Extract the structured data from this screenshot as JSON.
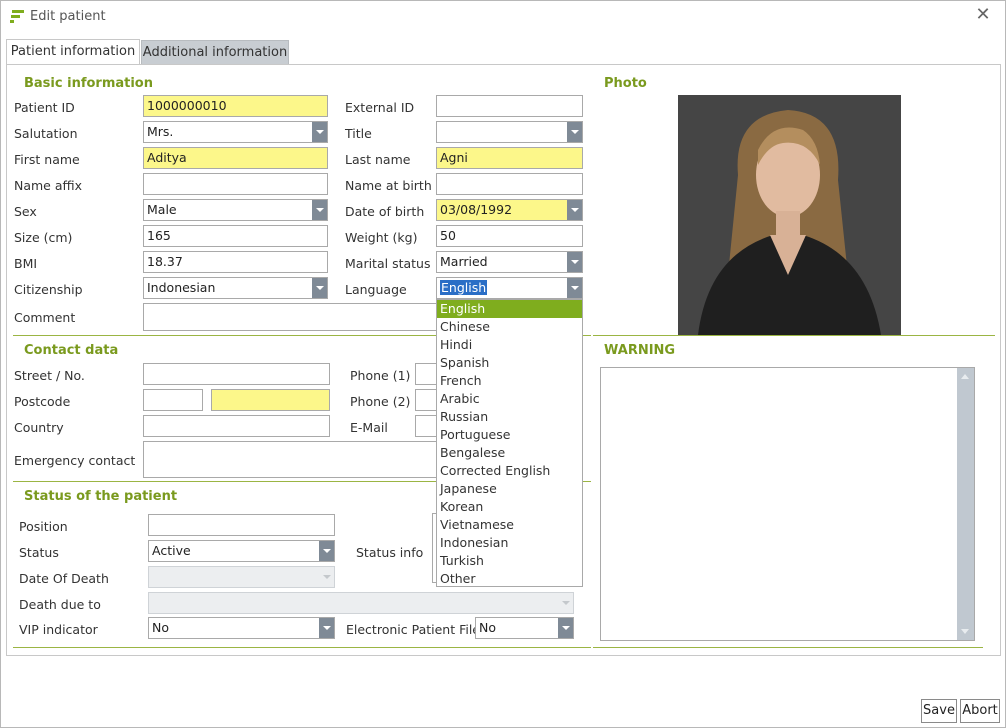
{
  "window": {
    "title": "Edit patient"
  },
  "tabs": [
    {
      "label": "Patient information"
    },
    {
      "label": "Additional information"
    }
  ],
  "basic": {
    "title": "Basic information",
    "patient_id_label": "Patient ID",
    "patient_id": "1000000010",
    "external_id_label": "External ID",
    "external_id": "",
    "salutation_label": "Salutation",
    "salutation": "Mrs.",
    "title_label": "Title",
    "title_value": "",
    "first_name_label": "First name",
    "first_name": "Aditya",
    "last_name_label": "Last name",
    "last_name": "Agni",
    "name_affix_label": "Name affix",
    "name_affix": "",
    "name_at_birth_label": "Name at birth",
    "name_at_birth": "",
    "sex_label": "Sex",
    "sex": "Male",
    "dob_label": "Date of birth",
    "dob": "03/08/1992",
    "size_label": "Size (cm)",
    "size": "165",
    "weight_label": "Weight (kg)",
    "weight": "50",
    "bmi_label": "BMI",
    "bmi": "18.37",
    "marital_label": "Marital status",
    "marital": "Married",
    "citizenship_label": "Citizenship",
    "citizenship": "Indonesian",
    "language_label": "Language",
    "language": "English",
    "comment_label": "Comment",
    "comment": ""
  },
  "photo": {
    "title": "Photo"
  },
  "contact": {
    "title": "Contact data",
    "street_label": "Street / No.",
    "street": "",
    "postcode_label": "Postcode",
    "postcode": "",
    "city": "",
    "country_label": "Country",
    "country": "",
    "emergency_label": "Emergency contact",
    "emergency": "",
    "phone1_label": "Phone (1)",
    "phone2_label": "Phone (2)",
    "email_label": "E-Mail"
  },
  "warning": {
    "title": "WARNING"
  },
  "status": {
    "title": "Status of the patient",
    "position_label": "Position",
    "position": "",
    "status_label": "Status",
    "status": "Active",
    "status_info_label": "Status info",
    "dod_label": "Date Of Death",
    "dod": "",
    "death_due_label": "Death due to",
    "death_due": "",
    "vip_label": "VIP indicator",
    "vip": "No",
    "epf_label": "Electronic Patient File",
    "epf": "No"
  },
  "language_options": [
    "English",
    "Chinese",
    "Hindi",
    "Spanish",
    "French",
    "Arabic",
    "Russian",
    "Portuguese",
    "Bengalese",
    "Corrected English",
    "Japanese",
    "Korean",
    "Vietnamese",
    "Indonesian",
    "Turkish",
    "Other"
  ],
  "buttons": {
    "save": "Save",
    "abort": "Abort"
  },
  "colors": {
    "accent": "#7a9a1e",
    "required": "#fcf78a",
    "select_highlight": "#7fad1e"
  }
}
